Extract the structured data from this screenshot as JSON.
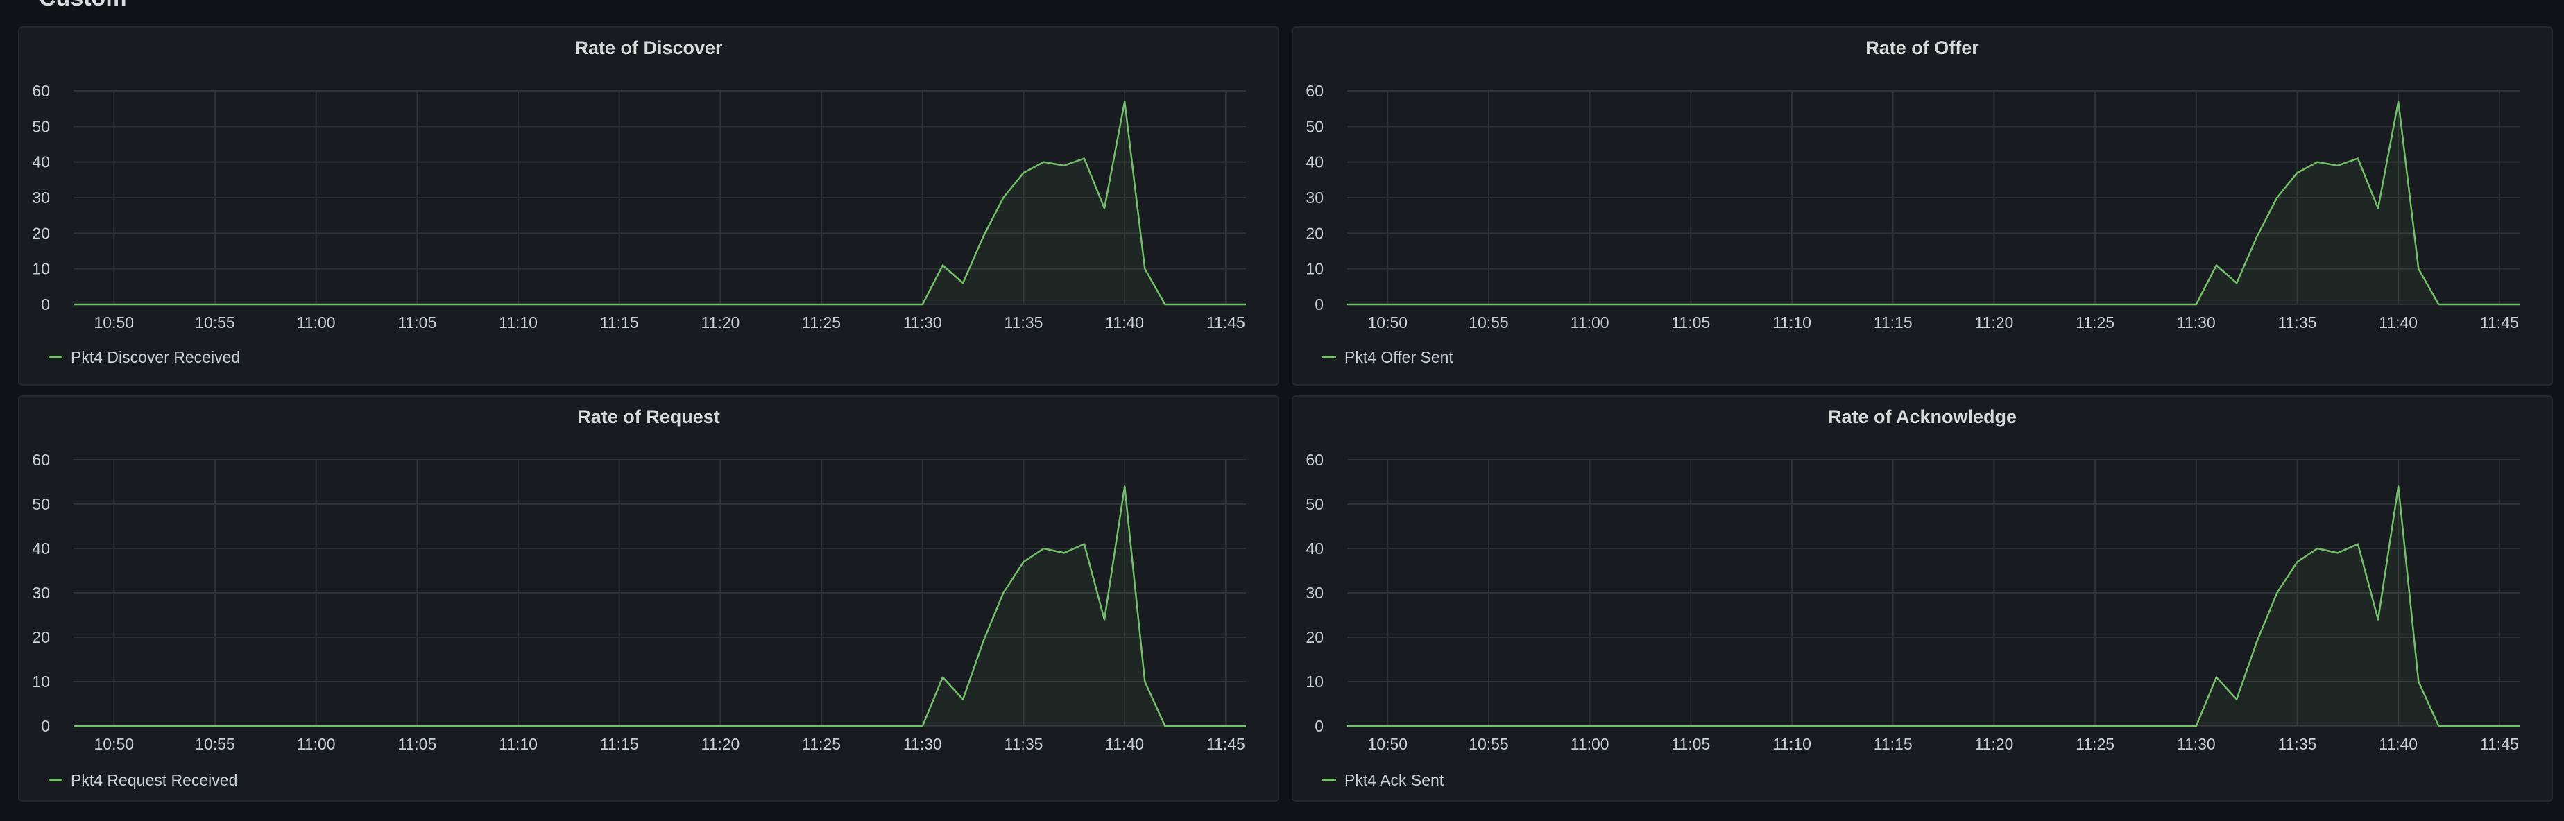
{
  "dashboard": {
    "row_title": "Custom"
  },
  "colors": {
    "series": "#73bf69",
    "fill": "rgba(115,191,105,0.08)",
    "grid": "#2f3137",
    "panel_bg": "#181b1f"
  },
  "panels": [
    {
      "title": "Rate of Discover",
      "chart_data": {
        "type": "area",
        "title": "Rate of Discover",
        "x_ticks": [
          "10:50",
          "10:55",
          "11:00",
          "11:05",
          "11:10",
          "11:15",
          "11:20",
          "11:25",
          "11:30",
          "11:35",
          "11:40",
          "11:45"
        ],
        "x_range": [
          "10:48",
          "11:46"
        ],
        "ylim": [
          0,
          60
        ],
        "y_ticks": [
          0,
          10,
          20,
          30,
          40,
          50,
          60
        ],
        "grid": true,
        "legend_position": "bottom-left",
        "series": [
          {
            "name": "Pkt4 Discover Received",
            "points": [
              [
                "10:48",
                0
              ],
              [
                "11:30",
                0
              ],
              [
                "11:31",
                11
              ],
              [
                "11:32",
                6
              ],
              [
                "11:33",
                19
              ],
              [
                "11:34",
                30
              ],
              [
                "11:35",
                37
              ],
              [
                "11:36",
                40
              ],
              [
                "11:37",
                39
              ],
              [
                "11:38",
                41
              ],
              [
                "11:39",
                27
              ],
              [
                "11:40",
                57
              ],
              [
                "11:41",
                10
              ],
              [
                "11:42",
                0
              ],
              [
                "11:46",
                0
              ]
            ]
          }
        ]
      }
    },
    {
      "title": "Rate of Offer",
      "chart_data": {
        "type": "area",
        "title": "Rate of Offer",
        "x_ticks": [
          "10:50",
          "10:55",
          "11:00",
          "11:05",
          "11:10",
          "11:15",
          "11:20",
          "11:25",
          "11:30",
          "11:35",
          "11:40",
          "11:45"
        ],
        "x_range": [
          "10:48",
          "11:46"
        ],
        "ylim": [
          0,
          60
        ],
        "y_ticks": [
          0,
          10,
          20,
          30,
          40,
          50,
          60
        ],
        "grid": true,
        "legend_position": "bottom-left",
        "series": [
          {
            "name": "Pkt4 Offer Sent",
            "points": [
              [
                "10:48",
                0
              ],
              [
                "11:30",
                0
              ],
              [
                "11:31",
                11
              ],
              [
                "11:32",
                6
              ],
              [
                "11:33",
                19
              ],
              [
                "11:34",
                30
              ],
              [
                "11:35",
                37
              ],
              [
                "11:36",
                40
              ],
              [
                "11:37",
                39
              ],
              [
                "11:38",
                41
              ],
              [
                "11:39",
                27
              ],
              [
                "11:40",
                57
              ],
              [
                "11:41",
                10
              ],
              [
                "11:42",
                0
              ],
              [
                "11:46",
                0
              ]
            ]
          }
        ]
      }
    },
    {
      "title": "Rate of Request",
      "chart_data": {
        "type": "area",
        "title": "Rate of Request",
        "x_ticks": [
          "10:50",
          "10:55",
          "11:00",
          "11:05",
          "11:10",
          "11:15",
          "11:20",
          "11:25",
          "11:30",
          "11:35",
          "11:40",
          "11:45"
        ],
        "x_range": [
          "10:48",
          "11:46"
        ],
        "ylim": [
          0,
          60
        ],
        "y_ticks": [
          0,
          10,
          20,
          30,
          40,
          50,
          60
        ],
        "grid": true,
        "legend_position": "bottom-left",
        "series": [
          {
            "name": "Pkt4 Request Received",
            "points": [
              [
                "10:48",
                0
              ],
              [
                "11:30",
                0
              ],
              [
                "11:31",
                11
              ],
              [
                "11:32",
                6
              ],
              [
                "11:33",
                19
              ],
              [
                "11:34",
                30
              ],
              [
                "11:35",
                37
              ],
              [
                "11:36",
                40
              ],
              [
                "11:37",
                39
              ],
              [
                "11:38",
                41
              ],
              [
                "11:39",
                24
              ],
              [
                "11:40",
                54
              ],
              [
                "11:41",
                10
              ],
              [
                "11:42",
                0
              ],
              [
                "11:46",
                0
              ]
            ]
          }
        ]
      }
    },
    {
      "title": "Rate of Acknowledge",
      "chart_data": {
        "type": "area",
        "title": "Rate of Acknowledge",
        "x_ticks": [
          "10:50",
          "10:55",
          "11:00",
          "11:05",
          "11:10",
          "11:15",
          "11:20",
          "11:25",
          "11:30",
          "11:35",
          "11:40",
          "11:45"
        ],
        "x_range": [
          "10:48",
          "11:46"
        ],
        "ylim": [
          0,
          60
        ],
        "y_ticks": [
          0,
          10,
          20,
          30,
          40,
          50,
          60
        ],
        "grid": true,
        "legend_position": "bottom-left",
        "series": [
          {
            "name": "Pkt4 Ack Sent",
            "points": [
              [
                "10:48",
                0
              ],
              [
                "11:30",
                0
              ],
              [
                "11:31",
                11
              ],
              [
                "11:32",
                6
              ],
              [
                "11:33",
                19
              ],
              [
                "11:34",
                30
              ],
              [
                "11:35",
                37
              ],
              [
                "11:36",
                40
              ],
              [
                "11:37",
                39
              ],
              [
                "11:38",
                41
              ],
              [
                "11:39",
                24
              ],
              [
                "11:40",
                54
              ],
              [
                "11:41",
                10
              ],
              [
                "11:42",
                0
              ],
              [
                "11:46",
                0
              ]
            ]
          }
        ]
      }
    }
  ]
}
